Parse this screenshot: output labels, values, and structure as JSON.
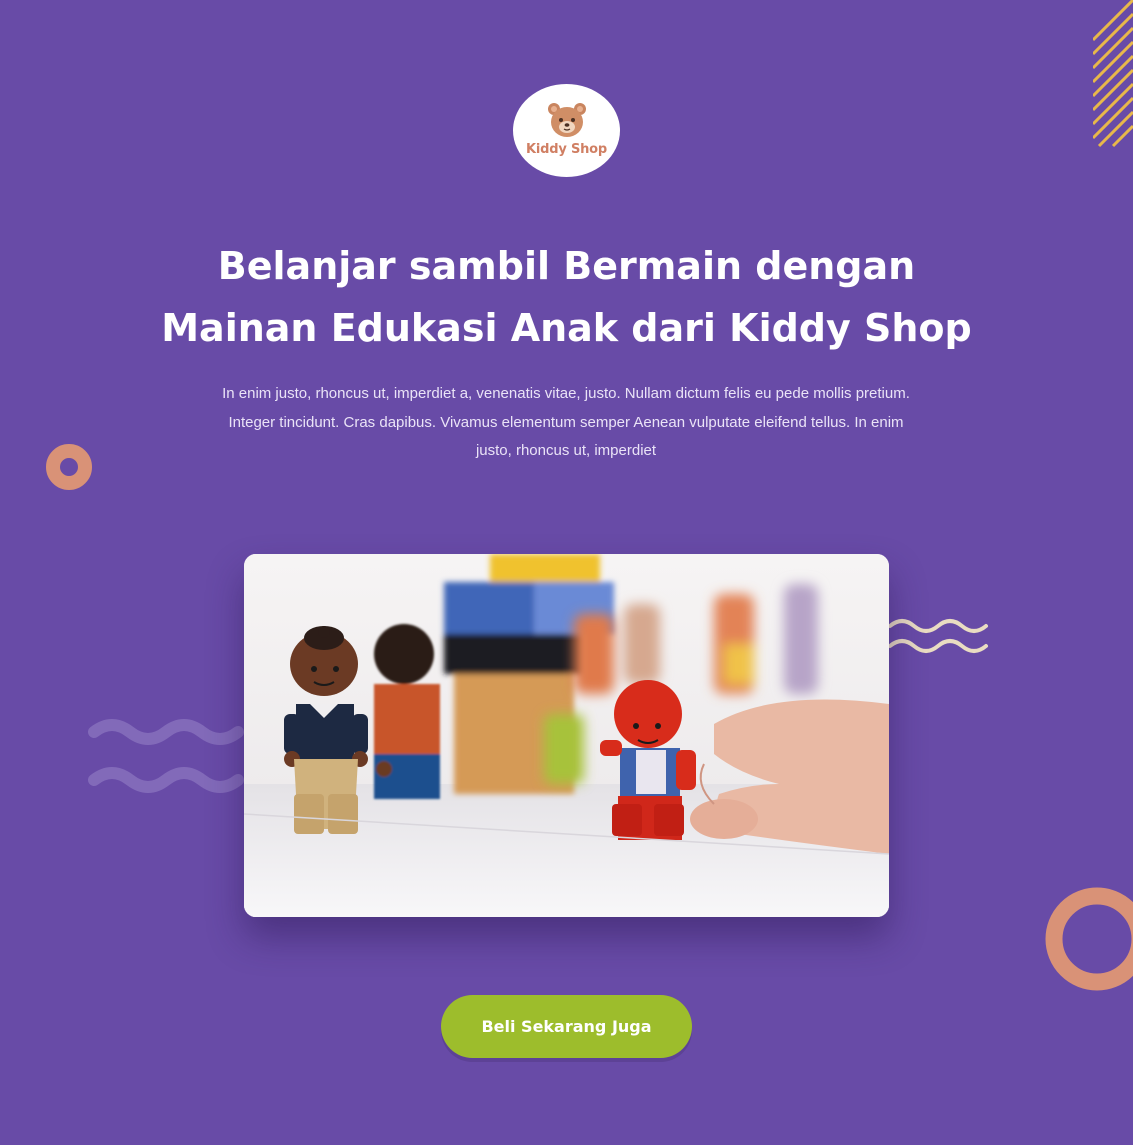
{
  "brand": {
    "name": "Kiddy Shop",
    "logo_icon": "bear-face-icon"
  },
  "hero": {
    "title_line1": "Belanjar sambil Bermain dengan",
    "title_line2": "Mainan Edukasi Anak dari Kiddy Shop",
    "description": "In enim justo, rhoncus ut, imperdiet a, venenatis vitae, justo. Nullam dictum felis eu pede mollis pretium. Integer tincidunt. Cras dapibus. Vivamus elementum semper Aenean vulputate eleifend tellus. In enim justo, rhoncus ut, imperdiet",
    "image_subject": "toy-figures-photo",
    "cta_label": "Beli Sekarang Juga"
  },
  "colors": {
    "background": "#684ba7",
    "accent_green": "#9dbd2c",
    "accent_peach": "#d99277",
    "accent_yellow": "#f0c24a",
    "logo_text": "#d07f63"
  }
}
